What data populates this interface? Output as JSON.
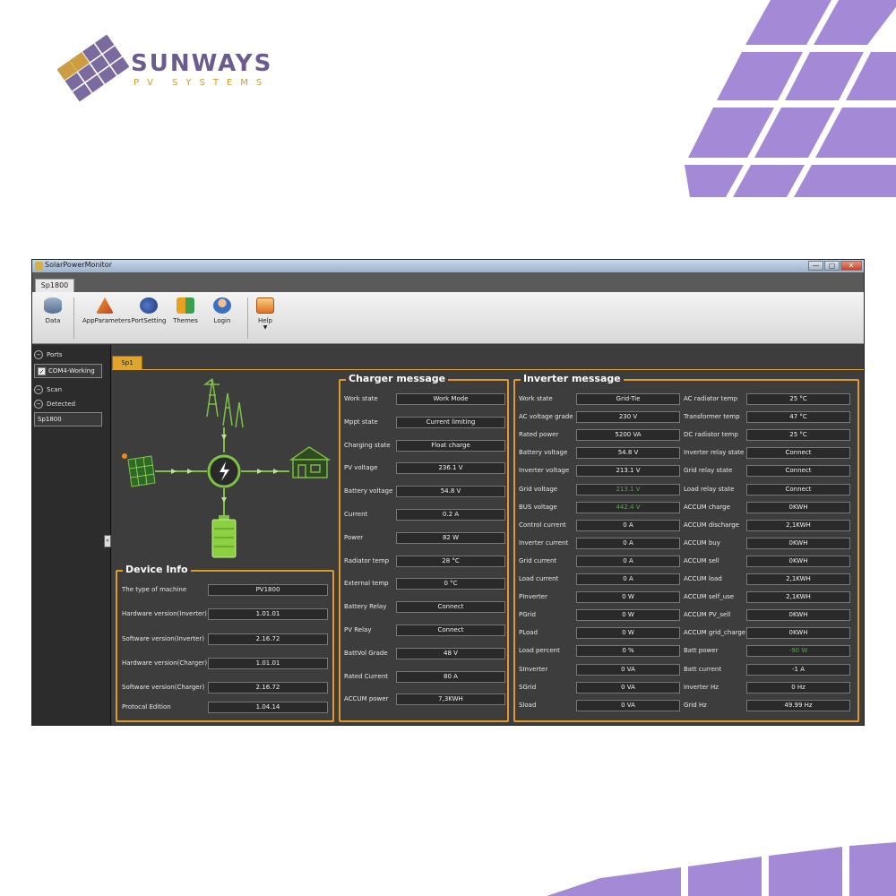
{
  "brand": {
    "name": "SUNWAYS",
    "tagline": "PV SYSTEMS"
  },
  "window": {
    "title": "SolarPowerMonitor",
    "controls": [
      "—",
      "▢",
      "✕"
    ]
  },
  "ribbon_tab": "Sp1800",
  "ribbon": {
    "data": "Data",
    "app_parameters": "AppParameters",
    "port_setting": "PortSetting",
    "themes": "Themes",
    "login": "Login",
    "help": "Help"
  },
  "sidebar": {
    "ports": "Ports",
    "com": "COM4-Working",
    "scan": "Scan",
    "detected": "Detected",
    "device": "Sp1800",
    "grip": "«"
  },
  "content_tab": "Sp1",
  "device_info": {
    "title": "Device Info",
    "rows": [
      {
        "label": "The type of machine",
        "value": "PV1800"
      },
      {
        "label": "Hardware version(Inverter)",
        "value": "1.01.01"
      },
      {
        "label": "Software version(Inverter)",
        "value": "2.16.72"
      },
      {
        "label": "Hardware version(Charger)",
        "value": "1.01.01"
      },
      {
        "label": "Software version(Charger)",
        "value": "2.16.72"
      },
      {
        "label": "Protocal Edition",
        "value": "1.04.14"
      }
    ]
  },
  "charger": {
    "title": "Charger message",
    "rows": [
      {
        "label": "Work state",
        "value": "Work Mode"
      },
      {
        "label": "Mppt state",
        "value": "Current limiting"
      },
      {
        "label": "Charging state",
        "value": "Float charge"
      },
      {
        "label": "PV voltage",
        "value": "236.1 V"
      },
      {
        "label": "Battery voltage",
        "value": "54.8 V"
      },
      {
        "label": "Current",
        "value": "0.2 A"
      },
      {
        "label": "Power",
        "value": "82 W"
      },
      {
        "label": "Radiator temp",
        "value": "28 °C"
      },
      {
        "label": "External temp",
        "value": "0 °C"
      },
      {
        "label": "Battery Relay",
        "value": "Connect"
      },
      {
        "label": "PV Relay",
        "value": "Connect"
      },
      {
        "label": "BattVol Grade",
        "value": "48 V"
      },
      {
        "label": "Rated Current",
        "value": "80 A"
      },
      {
        "label": "ACCUM power",
        "value": "7,3KWH"
      }
    ]
  },
  "inverter": {
    "title": "Inverter message",
    "left": [
      {
        "label": "Work state",
        "value": "Grid-Tie"
      },
      {
        "label": "AC voltage grade",
        "value": "230 V"
      },
      {
        "label": "Rated power",
        "value": "5200 VA"
      },
      {
        "label": "Battery voltage",
        "value": "54.8 V"
      },
      {
        "label": "Inverter voltage",
        "value": "213.1 V"
      },
      {
        "label": "Grid voltage",
        "value": "213.1 V"
      },
      {
        "label": "BUS voltage",
        "value": "442.4 V"
      },
      {
        "label": "Control current",
        "value": "0 A"
      },
      {
        "label": "Inverter current",
        "value": "0 A"
      },
      {
        "label": "Grid current",
        "value": "0 A"
      },
      {
        "label": "Load current",
        "value": "0 A"
      },
      {
        "label": "PInverter",
        "value": "0 W"
      },
      {
        "label": "PGrid",
        "value": "0 W"
      },
      {
        "label": "PLoad",
        "value": "0 W"
      },
      {
        "label": "Load percent",
        "value": "0 %"
      },
      {
        "label": "SInverter",
        "value": "0 VA"
      },
      {
        "label": "SGrid",
        "value": "0 VA"
      },
      {
        "label": "Sload",
        "value": "0 VA"
      }
    ],
    "right": [
      {
        "label": "AC radiator temp",
        "value": "25 °C"
      },
      {
        "label": "Transformer temp",
        "value": "47 °C"
      },
      {
        "label": "DC radiator temp",
        "value": "25 °C"
      },
      {
        "label": "Inverter relay state",
        "value": "Connect"
      },
      {
        "label": "Grid relay state",
        "value": "Connect"
      },
      {
        "label": "Load relay state",
        "value": "Connect"
      },
      {
        "label": "ACCUM charge",
        "value": "0KWH"
      },
      {
        "label": "ACCUM discharge",
        "value": "2,1KWH"
      },
      {
        "label": "ACCUM buy",
        "value": "0KWH"
      },
      {
        "label": "ACCUM sell",
        "value": "0KWH"
      },
      {
        "label": "ACCUM load",
        "value": "2,1KWH"
      },
      {
        "label": "ACCUM self_use",
        "value": "2,1KWH"
      },
      {
        "label": "ACCUM PV_sell",
        "value": "0KWH"
      },
      {
        "label": "ACCUM grid_charge",
        "value": "0KWH"
      },
      {
        "label": "Batt power",
        "value": "-90 W"
      },
      {
        "label": "Batt current",
        "value": "-1 A"
      },
      {
        "label": "Inverter Hz",
        "value": "0 Hz"
      },
      {
        "label": "Grid Hz",
        "value": "49.99 Hz"
      }
    ]
  },
  "colors": {
    "accent": "#e09a2c",
    "diagram_green": "#7dc243",
    "deco_purple": "#a48ad6"
  }
}
